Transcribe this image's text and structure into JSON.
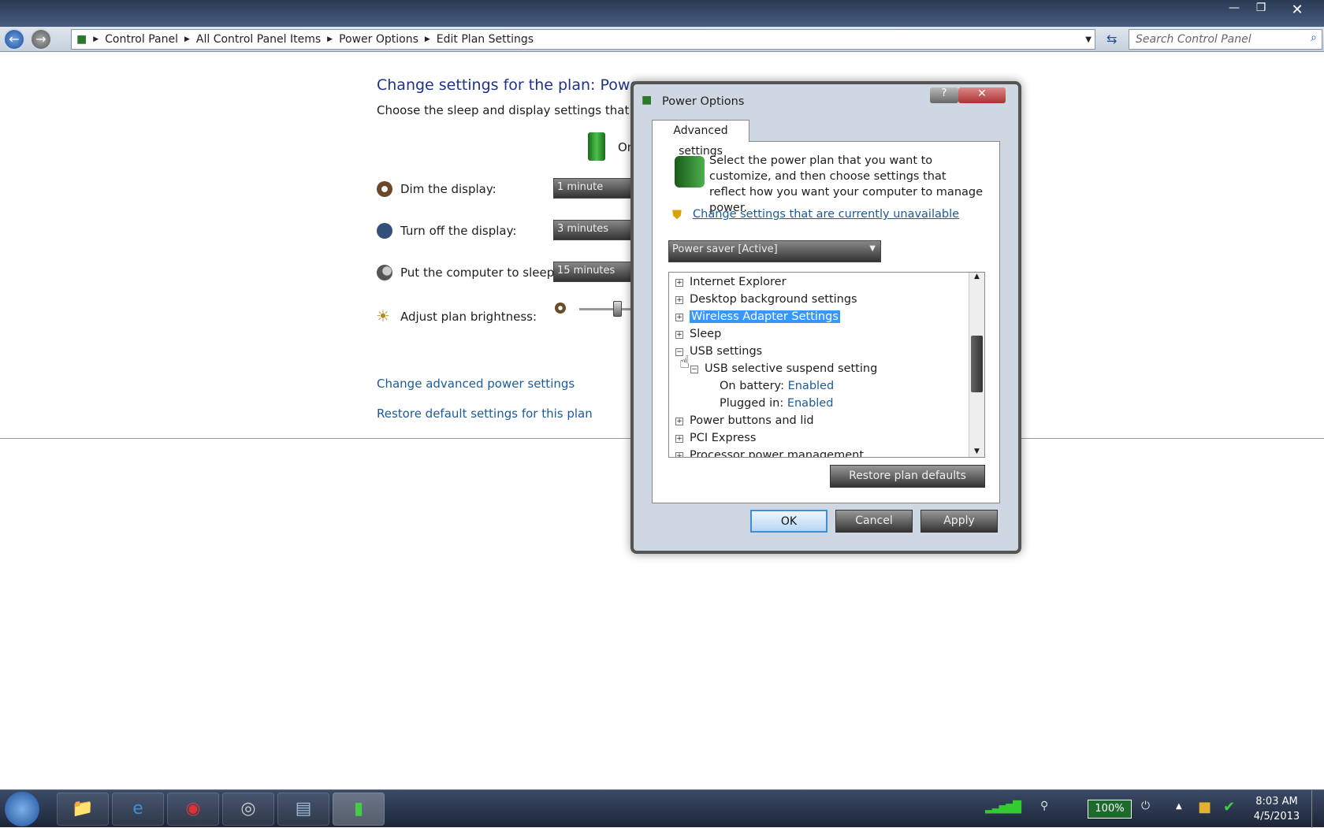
{
  "explorer": {
    "breadcrumb": [
      "Control Panel",
      "All Control Panel Items",
      "Power Options",
      "Edit Plan Settings"
    ],
    "search_placeholder": "Search Control Panel",
    "heading": "Change settings for the plan: Power sa",
    "subtitle": "Choose the sleep and display settings that you wa",
    "column_on": "On",
    "settings": [
      {
        "label": "Dim the display:",
        "value": "1 minute",
        "icon": "dim-display-icon"
      },
      {
        "label": "Turn off the display:",
        "value": "3 minutes",
        "icon": "monitor-icon"
      },
      {
        "label": "Put the computer to sleep:",
        "value": "15 minutes",
        "icon": "moon-icon"
      }
    ],
    "brightness_label": "Adjust plan brightness:",
    "links": [
      "Change advanced power settings",
      "Restore default settings for this plan"
    ]
  },
  "dialog": {
    "title": "Power Options",
    "tab": "Advanced settings",
    "intro": "Select the power plan that you want to customize, and then choose settings that reflect how you want your computer to manage power.",
    "admin_link": "Change settings that are currently unavailable",
    "plan_select": "Power saver [Active]",
    "tree": [
      {
        "label": "Internet Explorer",
        "expanded": false,
        "level": 0
      },
      {
        "label": "Desktop background settings",
        "expanded": false,
        "level": 0
      },
      {
        "label": "Wireless Adapter Settings",
        "expanded": false,
        "level": 0,
        "selected": true
      },
      {
        "label": "Sleep",
        "expanded": false,
        "level": 0
      },
      {
        "label": "USB settings",
        "expanded": true,
        "level": 0
      },
      {
        "label": "USB selective suspend setting",
        "expanded": true,
        "level": 1
      }
    ],
    "usb_values": [
      {
        "label": "On battery:",
        "value": "Enabled"
      },
      {
        "label": "Plugged in:",
        "value": "Enabled"
      }
    ],
    "tree_rest": [
      "Power buttons and lid",
      "PCI Express",
      "Processor power management"
    ],
    "restore_button": "Restore plan defaults",
    "ok": "OK",
    "cancel": "Cancel",
    "apply": "Apply"
  },
  "taskbar": {
    "battery": "100%",
    "time": "8:03 AM",
    "date": "4/5/2013"
  },
  "colors": {
    "accent": "#3399ff",
    "link": "#1a5b9c",
    "heading": "#1e3287"
  }
}
